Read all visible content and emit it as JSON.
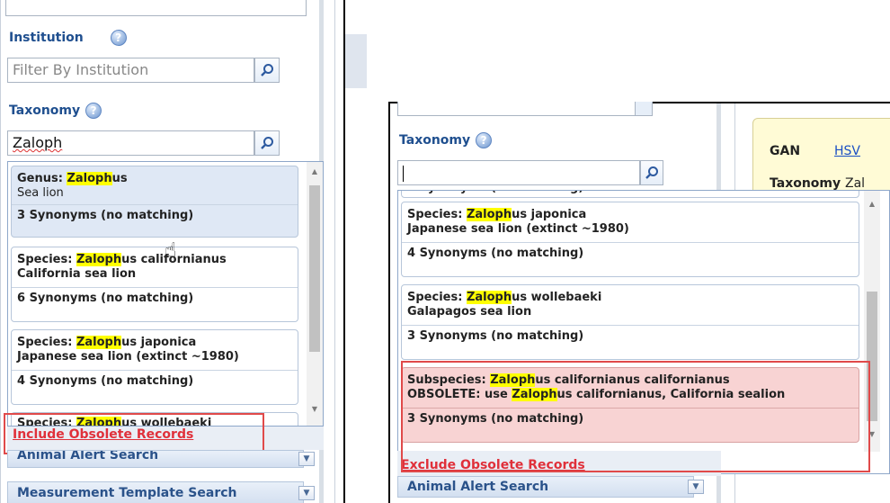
{
  "left": {
    "institution": {
      "label": "Institution",
      "help": "?",
      "placeholder": "Filter By Institution"
    },
    "taxonomy": {
      "label": "Taxonomy",
      "help": "?",
      "typed": "Zaloph"
    },
    "results": [
      {
        "rank": "Genus: ",
        "hl": "Zaloph",
        "rest": "us",
        "common": "Sea lion",
        "synonyms": "3 Synonyms (no matching)"
      },
      {
        "rank": "Species: ",
        "hl": "Zaloph",
        "rest": "us californianus",
        "common": "California sea lion",
        "synonyms": "6 Synonyms (no matching)"
      },
      {
        "rank": "Species: ",
        "hl": "Zaloph",
        "rest": "us japonica",
        "common": "Japanese sea lion (extinct ~1980)",
        "synonyms": "4 Synonyms (no matching)"
      },
      {
        "rank": "Species: ",
        "hl": "Zaloph",
        "rest": "us wollebaeki",
        "common": "",
        "synonyms": ""
      }
    ],
    "obsolete_link": "Include Obsolete Records",
    "accordions": [
      "Animal Alert Search",
      "Measurement Template Search"
    ]
  },
  "right": {
    "taxonomy": {
      "label": "Taxonomy",
      "help": "?",
      "value": ""
    },
    "partial_synonyms": "3 Synonyms (no matching)",
    "results": [
      {
        "rank": "Species: ",
        "hl": "Zaloph",
        "rest": "us japonica",
        "common": "Japanese sea lion (extinct ~1980)",
        "synonyms": "4 Synonyms (no matching)"
      },
      {
        "rank": "Species: ",
        "hl": "Zaloph",
        "rest": "us wollebaeki",
        "common": "Galapagos sea lion",
        "synonyms": "3 Synonyms (no matching)"
      }
    ],
    "obsolete_record": {
      "rank": "Subspecies: ",
      "hl": "Zaloph",
      "rest": "us californianus californianus",
      "note_pre": "OBSOLETE: use ",
      "note_hl": "Zaloph",
      "note_post": "us californianus, California sealion",
      "synonyms": "3 Synonyms (no matching)"
    },
    "obsolete_link": "Exclude Obsolete Records",
    "accordions": [
      "Animal Alert Search"
    ],
    "detail": {
      "gan_label": "GAN",
      "gan_value": "HSV",
      "taxonomy_label": "Taxonomy",
      "taxonomy_value": "Zal"
    }
  },
  "colors": {
    "highlight": "#ffff00",
    "link_red": "#e0303a",
    "obsolete_bg": "#f8d3d3",
    "selected_bg": "#dfe8f5"
  }
}
